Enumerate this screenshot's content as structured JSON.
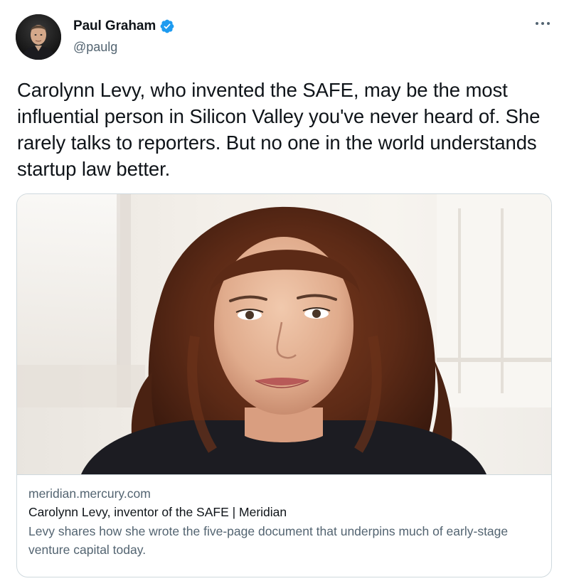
{
  "author": {
    "name": "Paul Graham",
    "handle": "@paulg",
    "verified": true
  },
  "tweet": {
    "text": "Carolynn Levy, who invented the SAFE, may be the most influential person in Silicon Valley you've never heard of. She rarely talks to reporters. But no one in the world understands startup law better."
  },
  "card": {
    "domain": "meridian.mercury.com",
    "title": "Carolynn Levy, inventor of the SAFE | Meridian",
    "description": "Levy shares how she wrote the five-page document that underpins much of early-stage venture capital today."
  },
  "icons": {
    "verified": "verified-badge-icon",
    "more": "more-options-icon"
  },
  "colors": {
    "text_primary": "#0f1419",
    "text_secondary": "#536471",
    "verified_blue": "#1d9bf0",
    "card_border": "#cfd9de"
  }
}
